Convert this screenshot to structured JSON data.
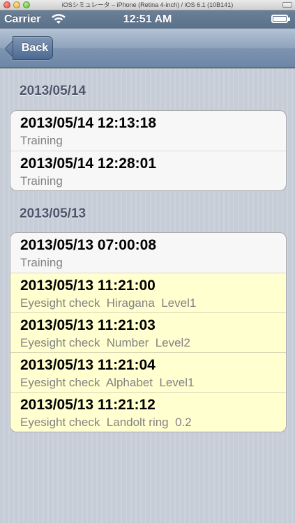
{
  "window": {
    "title": "iOSシミュレータ – iPhone (Retina 4-inch) / iOS 6.1 (10B141)"
  },
  "status_bar": {
    "carrier": "Carrier",
    "time": "12:51 AM"
  },
  "nav": {
    "back_label": "Back"
  },
  "sections": [
    {
      "header": "2013/05/14",
      "rows": [
        {
          "title": "2013/05/14 12:13:18",
          "subtitle": "Training",
          "highlighted": false
        },
        {
          "title": "2013/05/14 12:28:01",
          "subtitle": "Training",
          "highlighted": false
        }
      ]
    },
    {
      "header": "2013/05/13",
      "rows": [
        {
          "title": "2013/05/13 07:00:08",
          "subtitle": "Training",
          "highlighted": false
        },
        {
          "title": "2013/05/13 11:21:00",
          "subtitle": "Eyesight check  Hiragana  Level1",
          "highlighted": true
        },
        {
          "title": "2013/05/13 11:21:03",
          "subtitle": "Eyesight check  Number  Level2",
          "highlighted": true
        },
        {
          "title": "2013/05/13 11:21:04",
          "subtitle": "Eyesight check  Alphabet  Level1",
          "highlighted": true
        },
        {
          "title": "2013/05/13 11:21:12",
          "subtitle": "Eyesight check  Landolt ring  0.2",
          "highlighted": true
        }
      ]
    }
  ],
  "colors": {
    "highlight_row": "#ffffd0",
    "nav_bar": "#7d94b1",
    "section_header": "#4c566c"
  },
  "icons": {
    "wifi": "wifi-icon",
    "battery": "battery-icon"
  }
}
